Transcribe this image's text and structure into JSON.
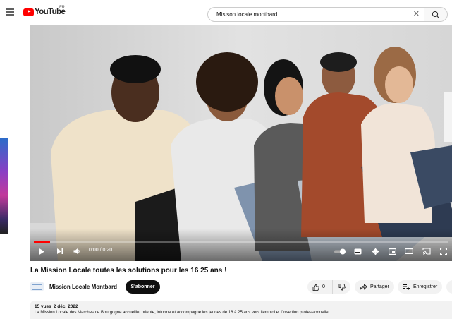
{
  "header": {
    "logo_text": "YouTube",
    "region": "FR",
    "search_value": "Misison locale montbard"
  },
  "player": {
    "time": "0:00 / 0:20",
    "progress": 0.04
  },
  "video": {
    "title": "La Mission Locale toutes les solutions pour les 16 25 ans !"
  },
  "channel": {
    "name": "Mission Locale Montbard",
    "subscribe_label": "S'abonner"
  },
  "actions": {
    "like_count": "0",
    "share_label": "Partager",
    "save_label": "Enregistrer"
  },
  "description": {
    "views": "15 vues",
    "date": "2 déc. 2022",
    "text": "La Mission Locale des Marches de Bourgogne accueille, oriente, informe et accompagne les jeunes de 16 à 25 ans vers l'emploi et l'insertion professionnelle."
  },
  "colors": {
    "brand_red": "#ff0000",
    "subscribe_bg": "#0f0f0f",
    "pill_bg": "#f2f2f2"
  }
}
